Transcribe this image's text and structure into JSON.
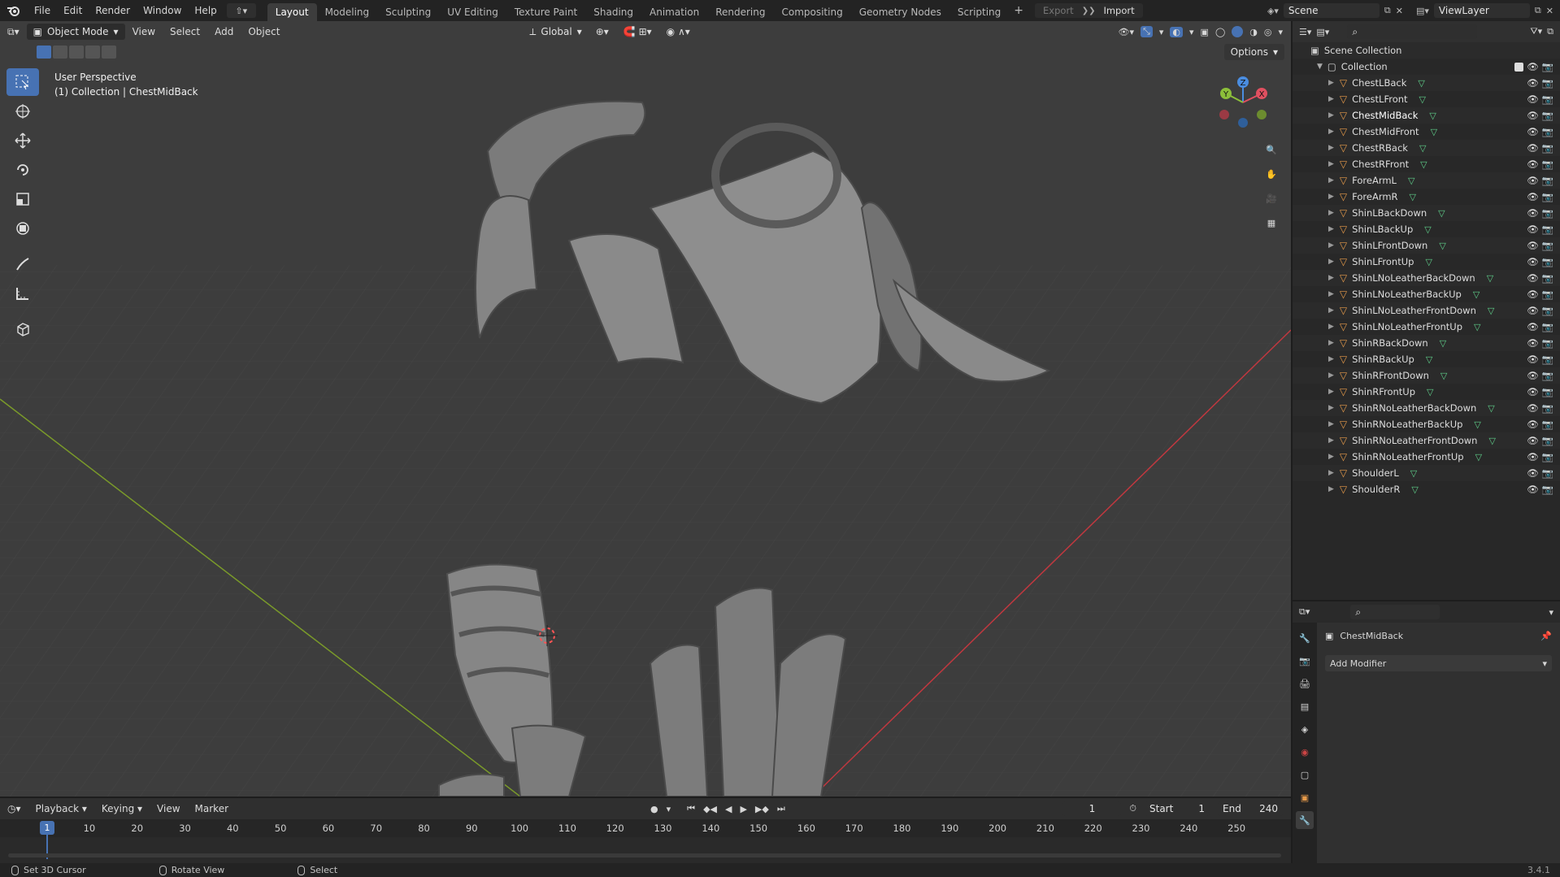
{
  "topbar": {
    "menus": [
      "File",
      "Edit",
      "Render",
      "Window",
      "Help"
    ],
    "workspaces": [
      "Layout",
      "Modeling",
      "Sculpting",
      "UV Editing",
      "Texture Paint",
      "Shading",
      "Animation",
      "Rendering",
      "Compositing",
      "Geometry Nodes",
      "Scripting"
    ],
    "active_workspace": "Layout",
    "export_label": "Export",
    "import_label": "Import",
    "scene_name": "Scene",
    "view_layer": "ViewLayer"
  },
  "viewport": {
    "mode": "Object Mode",
    "menus": [
      "View",
      "Select",
      "Add",
      "Object"
    ],
    "orientation": "Global",
    "options_label": "Options",
    "perspective_label": "User Perspective",
    "context_label": "(1) Collection | ChestMidBack",
    "gizmo_axes": [
      "X",
      "Y",
      "Z"
    ]
  },
  "outliner": {
    "root": "Scene Collection",
    "collection": "Collection",
    "objects": [
      "ChestLBack",
      "ChestLFront",
      "ChestMidBack",
      "ChestMidFront",
      "ChestRBack",
      "ChestRFront",
      "ForeArmL",
      "ForeArmR",
      "ShinLBackDown",
      "ShinLBackUp",
      "ShinLFrontDown",
      "ShinLFrontUp",
      "ShinLNoLeatherBackDown",
      "ShinLNoLeatherBackUp",
      "ShinLNoLeatherFrontDown",
      "ShinLNoLeatherFrontUp",
      "ShinRBackDown",
      "ShinRBackUp",
      "ShinRFrontDown",
      "ShinRFrontUp",
      "ShinRNoLeatherBackDown",
      "ShinRNoLeatherBackUp",
      "ShinRNoLeatherFrontDown",
      "ShinRNoLeatherFrontUp",
      "ShoulderL",
      "ShoulderR"
    ],
    "selected": "ChestMidBack"
  },
  "properties": {
    "object_name": "ChestMidBack",
    "add_modifier_label": "Add Modifier"
  },
  "timeline": {
    "menus": [
      "Playback",
      "Keying",
      "View",
      "Marker"
    ],
    "current_frame": "1",
    "start_label": "Start",
    "start_value": "1",
    "end_label": "End",
    "end_value": "240",
    "ticks": [
      "1",
      "10",
      "20",
      "30",
      "40",
      "50",
      "60",
      "70",
      "80",
      "90",
      "100",
      "110",
      "120",
      "130",
      "140",
      "150",
      "160",
      "170",
      "180",
      "190",
      "200",
      "210",
      "220",
      "230",
      "240",
      "250"
    ]
  },
  "statusbar": {
    "hint_left": "Set 3D Cursor",
    "hint_middle": "Rotate View",
    "hint_right": "Select",
    "version": "3.4.1"
  },
  "colors": {
    "accent": "#4772b3",
    "x_axis": "#e05060",
    "y_axis": "#8cbf3a",
    "z_axis": "#4a8de0",
    "object_orange": "#e69a4a"
  }
}
